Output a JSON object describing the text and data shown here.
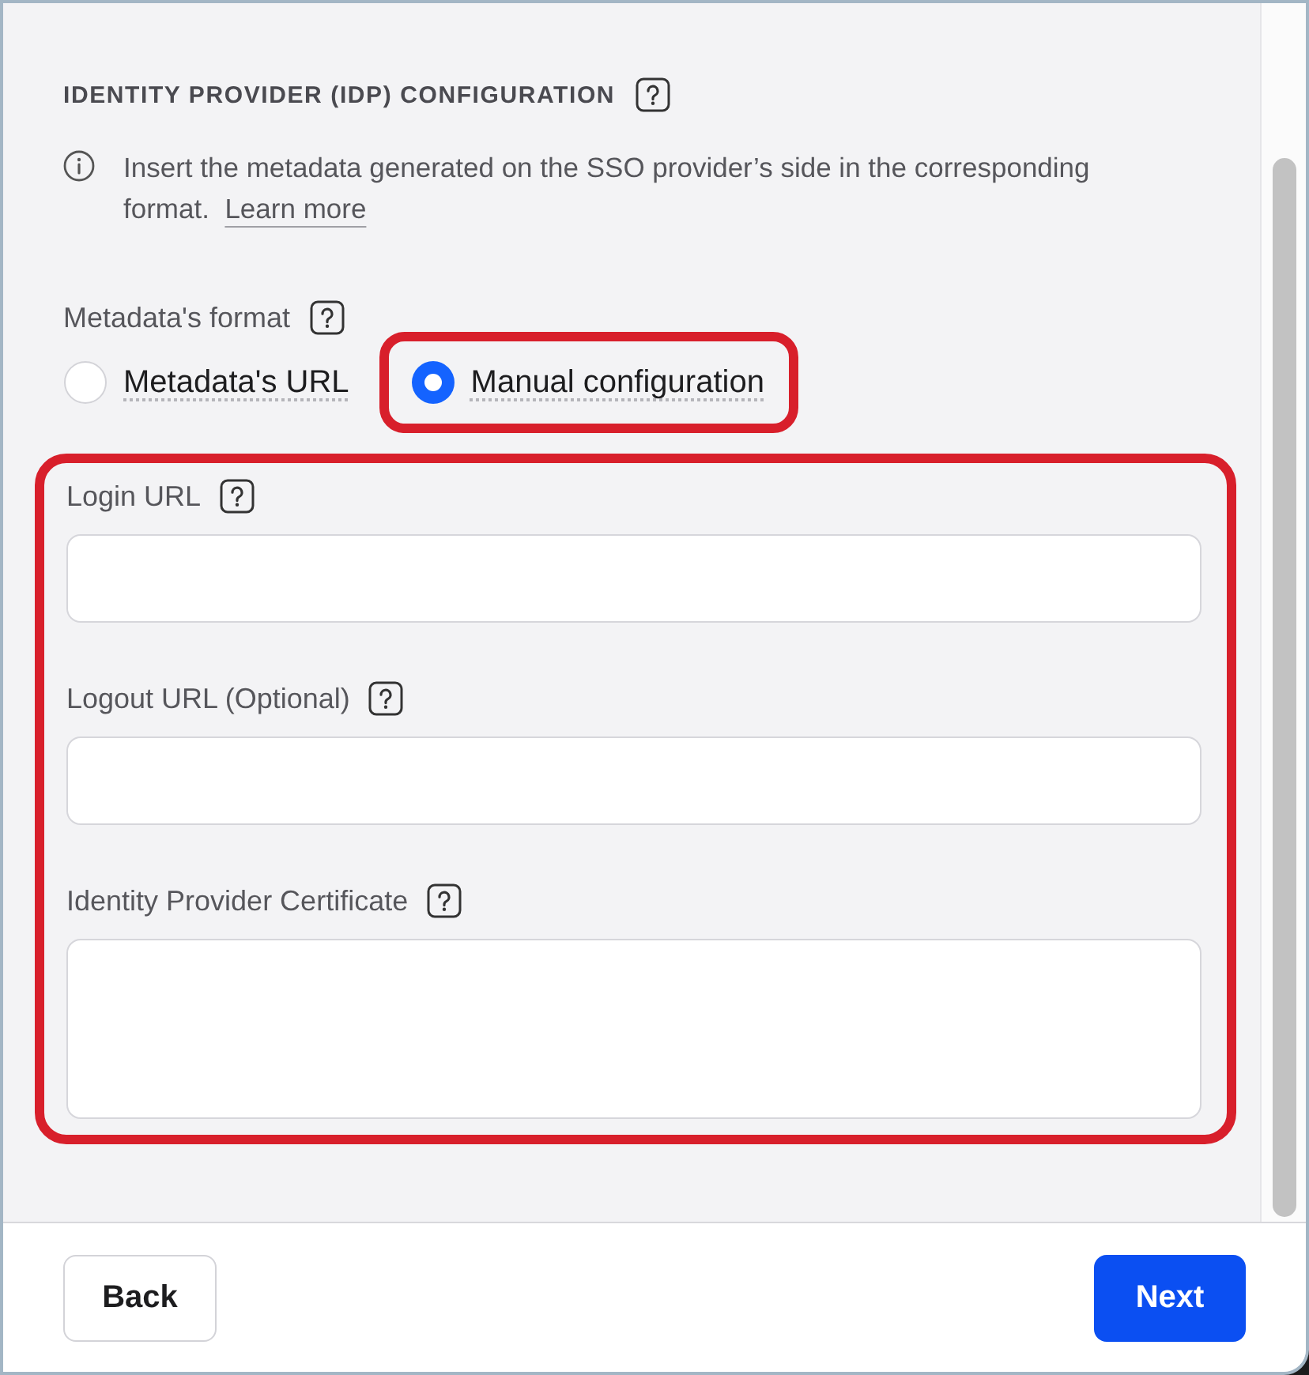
{
  "section": {
    "title": "IDENTITY PROVIDER (IDP) CONFIGURATION"
  },
  "info": {
    "text": "Insert the metadata generated on the SSO provider’s side in the corresponding format.",
    "link": "Learn more"
  },
  "format": {
    "label": "Metadata's format",
    "options": [
      {
        "label": "Metadata's URL",
        "selected": false,
        "highlighted": false
      },
      {
        "label": "Manual configuration",
        "selected": true,
        "highlighted": true
      }
    ]
  },
  "fields_group": {
    "highlighted": true,
    "fields": [
      {
        "label": "Login URL",
        "kind": "input"
      },
      {
        "label": "Logout URL (Optional)",
        "kind": "input"
      },
      {
        "label": "Identity Provider Certificate",
        "kind": "textarea"
      }
    ]
  },
  "footer": {
    "buttons": [
      {
        "label": "Back",
        "kind": "secondary"
      },
      {
        "label": "Next",
        "kind": "primary"
      }
    ]
  }
}
